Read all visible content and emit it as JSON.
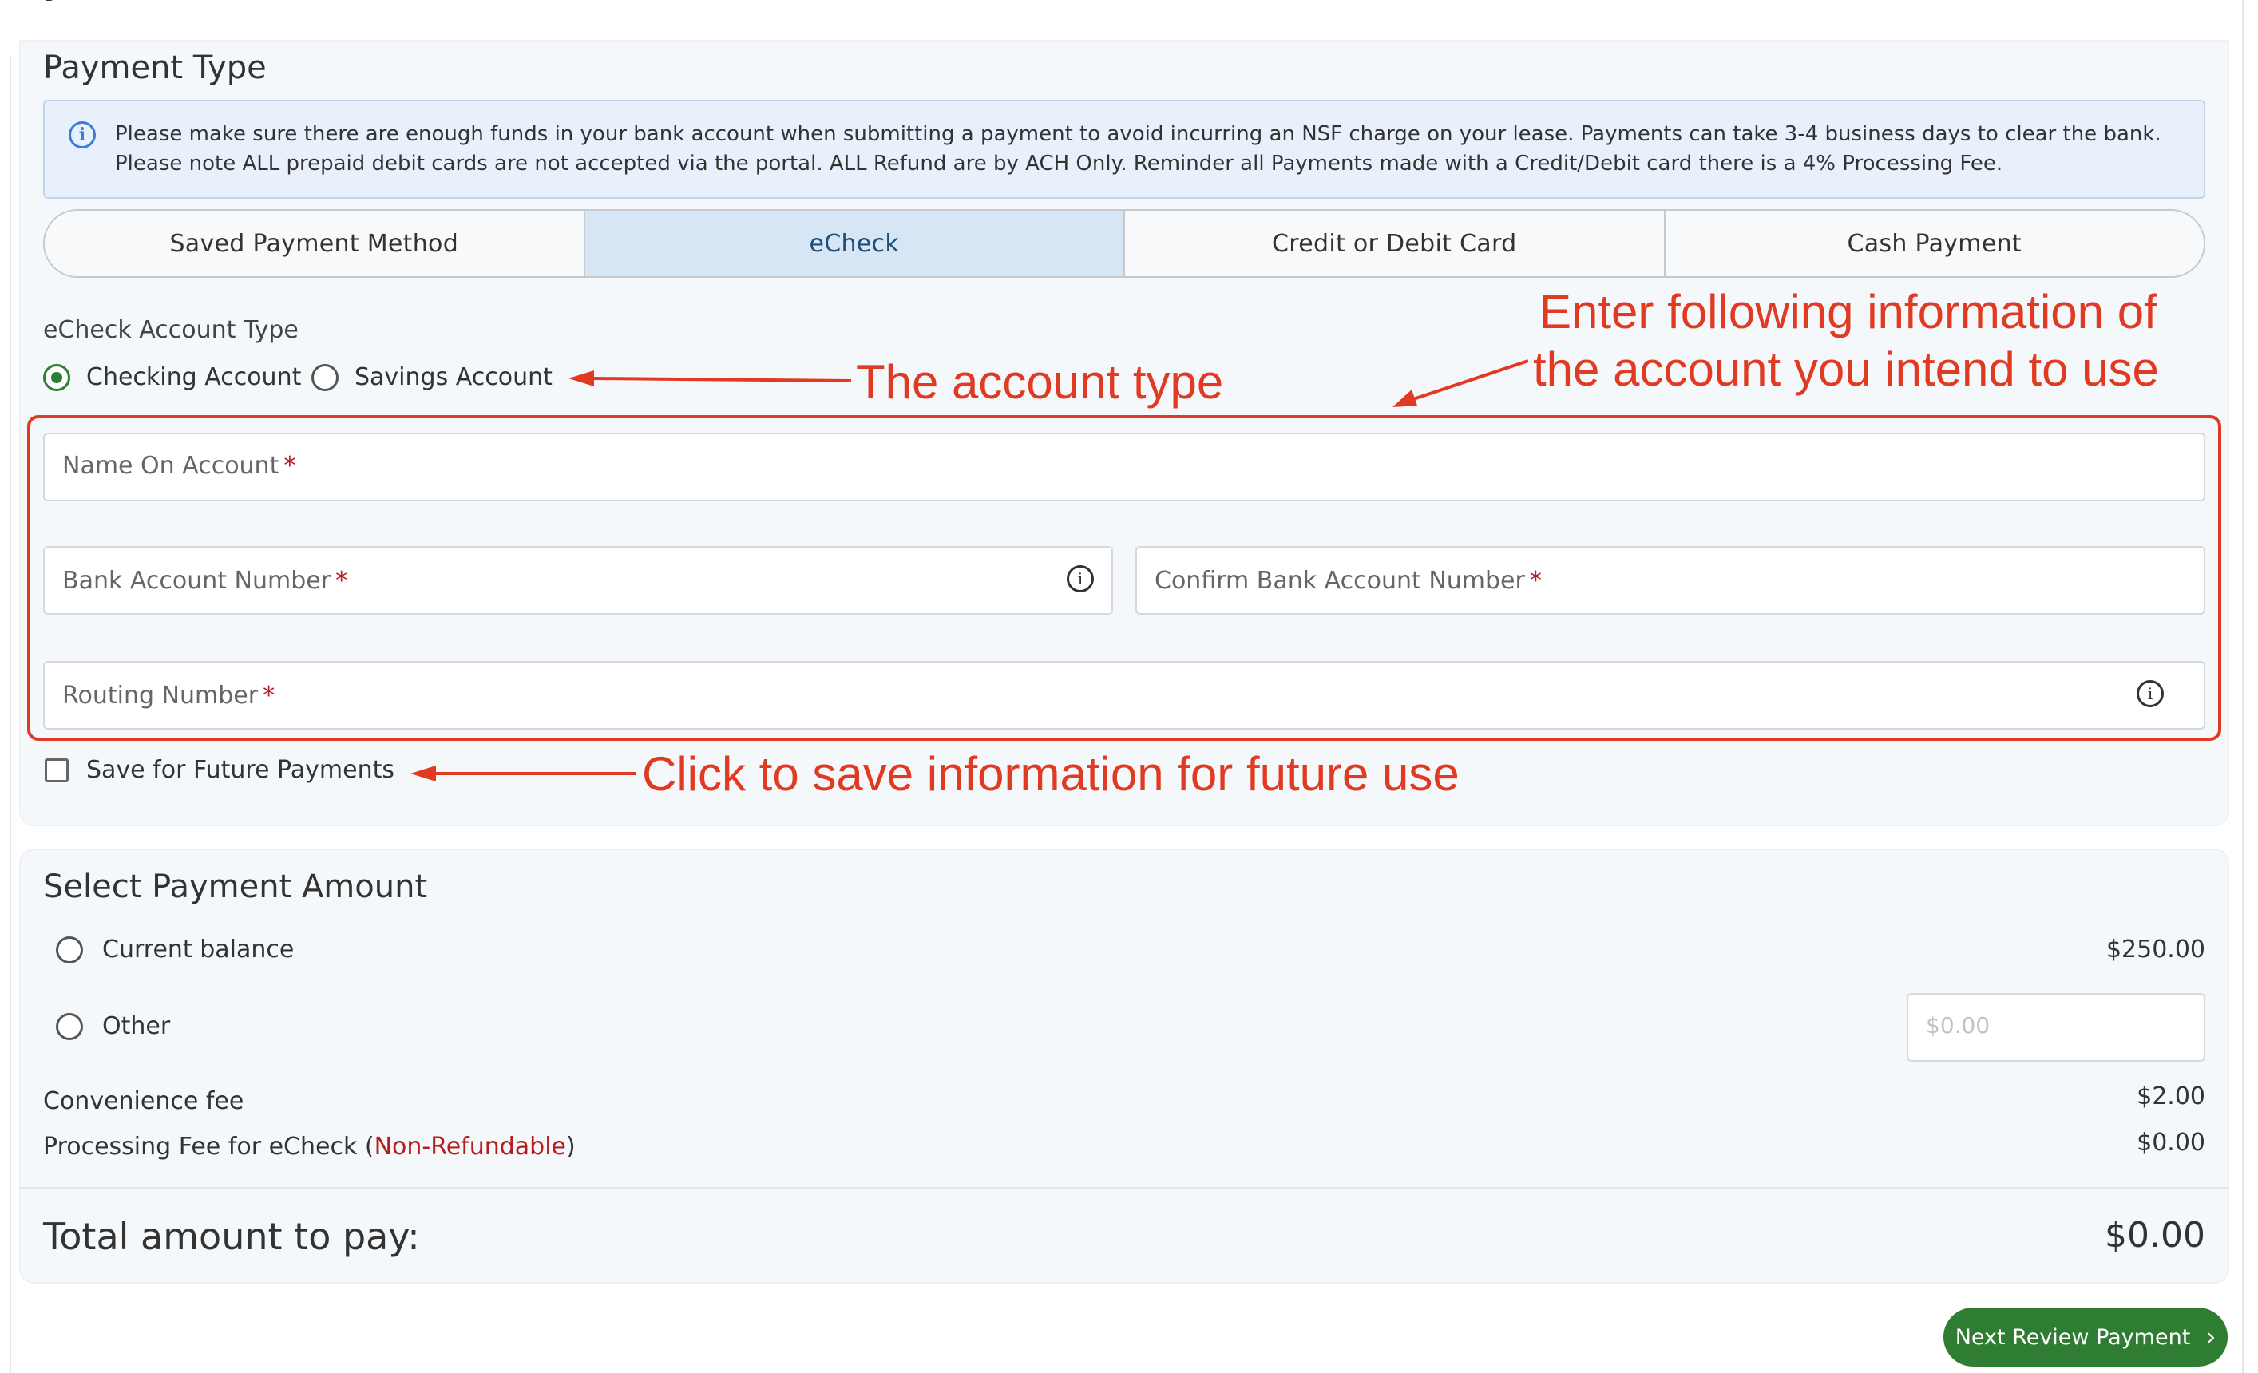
{
  "header": {
    "title_fragment": "y"
  },
  "payment_type": {
    "title": "Payment Type",
    "info_text": "Please make sure there are enough funds in your bank account when submitting a payment to avoid incurring an NSF charge on your lease. Payments can take 3-4 business days to clear the bank. Please note ALL prepaid debit cards are not accepted via the portal. ALL Refund are by ACH Only. Reminder all Payments made with a Credit/Debit card there is a 4% Processing Fee.",
    "info_icon": "info-icon",
    "tabs": [
      {
        "label": "Saved Payment Method",
        "active": false
      },
      {
        "label": "eCheck",
        "active": true
      },
      {
        "label": "Credit or Debit Card",
        "active": false
      },
      {
        "label": "Cash Payment",
        "active": false
      }
    ],
    "account_type_label": "eCheck Account Type",
    "account_types": [
      {
        "label": "Checking Account",
        "selected": true
      },
      {
        "label": "Savings Account",
        "selected": false
      }
    ],
    "fields": {
      "name": {
        "label": "Name On Account",
        "required_mark": "*",
        "value": ""
      },
      "bank_account": {
        "label": "Bank Account Number",
        "required_mark": "*",
        "value": ""
      },
      "confirm_bank_account": {
        "label": "Confirm Bank Account Number",
        "required_mark": "*",
        "value": ""
      },
      "routing": {
        "label": "Routing Number",
        "required_mark": "*",
        "value": ""
      }
    },
    "save_future_label": "Save for Future Payments",
    "save_future_checked": false
  },
  "annotations": {
    "account_type": "The account type",
    "enter_info_line1": "Enter following information of",
    "enter_info_line2": "the account you intend to use",
    "save_info": "Click to save information for future use",
    "color": "#e03a22"
  },
  "payment_amount": {
    "title": "Select Payment Amount",
    "options": [
      {
        "label": "Current balance",
        "amount": "$250.00",
        "selected": false
      },
      {
        "label": "Other",
        "placeholder": "$0.00",
        "selected": false
      }
    ],
    "convenience_fee_label": "Convenience fee",
    "convenience_fee": "$2.00",
    "processing_fee_prefix": "Processing Fee for eCheck (",
    "processing_fee_note": "Non-Refundable",
    "processing_fee_suffix": ")",
    "processing_fee": "$0.00",
    "total_label": "Total amount to pay:",
    "total": "$0.00"
  },
  "actions": {
    "next_label": "Next Review Payment",
    "next_icon": "chevron-right-icon"
  },
  "colors": {
    "accent_green": "#2e7d32",
    "active_tab_bg": "#d6e6f4",
    "info_banner_bg": "#e8f0fb",
    "required_red": "#b71c1c"
  }
}
